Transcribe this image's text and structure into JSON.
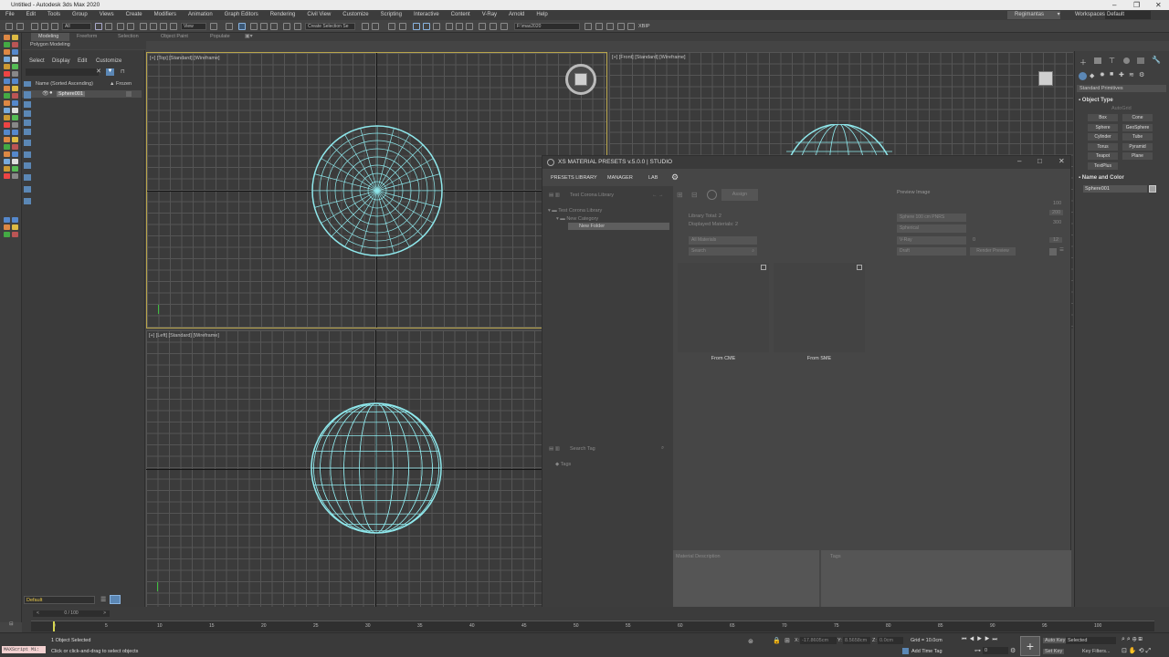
{
  "title_bar": {
    "title": "Untitled - Autodesk 3ds Max 2020"
  },
  "menu": [
    "File",
    "Edit",
    "Tools",
    "Group",
    "Views",
    "Create",
    "Modifiers",
    "Animation",
    "Graph Editors",
    "Rendering",
    "Civil View",
    "Customize",
    "Scripting",
    "Interactive",
    "Content",
    "V-Ray",
    "Arnold",
    "Help"
  ],
  "account": {
    "user": "Regimantas",
    "workspaces_label": "Workspaces:",
    "workspace": "Default"
  },
  "toolbar": {
    "selection_filter": "All",
    "ref_coord": "View",
    "selection_set": "Create Selection Se",
    "project_path": "F:\\max2020",
    "xbip": "XBIP"
  },
  "ribbon": {
    "tabs": [
      "Modeling",
      "Freeform",
      "Selection",
      "Object Paint",
      "Populate"
    ],
    "sub": "Polygon Modeling"
  },
  "scene_explorer": {
    "tabs": [
      "Select",
      "Display",
      "Edit",
      "Customize"
    ],
    "col_name": "Name (Sorted Ascending)",
    "col_frozen": "▲ Frozen",
    "item": "Sphere001",
    "layer": "Default"
  },
  "viewports": {
    "top": "[+] [Top] [Standard] [Wireframe]",
    "front": "[+] [Front] [Standard] [Wireframe]",
    "left": "[+] [Left] [Standard] [Wireframe]"
  },
  "xs": {
    "title": "XS MATERIAL PRESETS v.5.0.0 | STUDIO",
    "tabs": [
      "PRESETS LIBRARY",
      "MANAGER",
      "LAB"
    ],
    "library_combo": "Test Corona Library",
    "tree": [
      "Test Corona Library",
      "New Category",
      "New Folder"
    ],
    "assign": "Assign",
    "preview_image": "Preview Image",
    "library_total": "Library Total: 2",
    "displayed": "Displayed Materials: 2",
    "filter": "All Materials",
    "search": "Search",
    "sphere_combo": "Sphere 100 cm PNRS",
    "spherical": "Spherical",
    "vray": "V-Ray",
    "zero": "0",
    "draft": "Draft",
    "render_preview": "Render Preview",
    "n100": "100",
    "n200": "200",
    "n300": "300",
    "n12": "12",
    "thumbs": [
      "From CME",
      "From SME"
    ],
    "search_tag": "Search Tag",
    "tags": "Tags",
    "material_description": "Material Description",
    "tags_panel": "Tags"
  },
  "command_panel": {
    "dropdown": "Standard Primitives",
    "object_type": "Object Type",
    "autogrid": "AutoGrid",
    "buttons": [
      "Box",
      "Cone",
      "Sphere",
      "GeoSphere",
      "Cylinder",
      "Tube",
      "Torus",
      "Pyramid",
      "Teapot",
      "Plane",
      "TextPlus"
    ],
    "name_color": "Name and Color",
    "name": "Sphere001"
  },
  "timeline": {
    "frame": "0 / 100",
    "ticks": [
      "0",
      "5",
      "10",
      "15",
      "20",
      "25",
      "30",
      "35",
      "40",
      "45",
      "50",
      "55",
      "60",
      "65",
      "70",
      "75",
      "80",
      "85",
      "90",
      "95",
      "100"
    ]
  },
  "status": {
    "maxscript": "MAXScript Mi:",
    "selected": "1 Object Selected",
    "prompt": "Click or click-and-drag to select objects",
    "x_label": "X:",
    "x": "-17.8605cm",
    "y_label": "Y:",
    "y": "8.5658cm",
    "z_label": "Z:",
    "z": "0.0cm",
    "grid": "Grid = 10.0cm",
    "add_time_tag": "Add Time Tag",
    "auto_key": "Auto Key",
    "set_key": "Set Key",
    "selected_combo": "Selected",
    "key_filters": "Key Filters...",
    "frame": "0"
  }
}
